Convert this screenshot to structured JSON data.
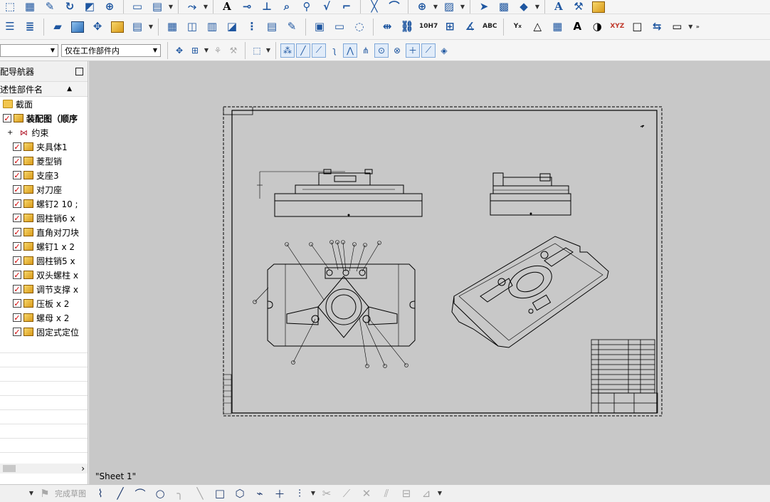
{
  "toolbar": {
    "row3": {
      "filter_value": "仅在工作部件内"
    },
    "labels": {
      "fit_tol": "10H7",
      "abc": "ABC",
      "xyz": "XYZ",
      "y_sub": "Y",
      "x_sub": "x"
    }
  },
  "navigator": {
    "title": "配导航器",
    "column_header": "述性部件名",
    "items": [
      {
        "label": "截面",
        "icon": "folder-icon",
        "checked": false,
        "bold": false
      },
      {
        "label": "装配图（顺序",
        "icon": "assembly-icon",
        "checked": true,
        "bold": true
      },
      {
        "label": "约束",
        "icon": "constraint-icon",
        "checked": false,
        "bold": false
      },
      {
        "label": "夹具体1",
        "icon": "part-icon",
        "checked": true,
        "bold": false
      },
      {
        "label": "菱型销",
        "icon": "part-icon",
        "checked": true,
        "bold": false
      },
      {
        "label": "支座3",
        "icon": "part-icon",
        "checked": true,
        "bold": false
      },
      {
        "label": "对刀座",
        "icon": "part-icon",
        "checked": true,
        "bold": false
      },
      {
        "label": "螺钉2 10 ;",
        "icon": "part-icon",
        "checked": true,
        "bold": false
      },
      {
        "label": "圆柱销6 x",
        "icon": "part-icon",
        "checked": true,
        "bold": false
      },
      {
        "label": "直角对刀块",
        "icon": "part-icon",
        "checked": true,
        "bold": false
      },
      {
        "label": "螺钉1 x 2",
        "icon": "part-icon",
        "checked": true,
        "bold": false
      },
      {
        "label": "圆柱销5 x",
        "icon": "part-icon",
        "checked": true,
        "bold": false
      },
      {
        "label": "双头螺柱 x",
        "icon": "part-icon",
        "checked": true,
        "bold": false
      },
      {
        "label": "调节支撑 x",
        "icon": "part-icon",
        "checked": true,
        "bold": false
      },
      {
        "label": "压板 x 2",
        "icon": "part-icon",
        "checked": true,
        "bold": false
      },
      {
        "label": "螺母 x 2",
        "icon": "part-icon",
        "checked": true,
        "bold": false
      },
      {
        "label": "固定式定位",
        "icon": "part-icon",
        "checked": true,
        "bold": false
      }
    ]
  },
  "drawing": {
    "sheet_label": "\"Sheet 1\""
  },
  "statusbar": {
    "finish_sketch": "完成草图"
  }
}
